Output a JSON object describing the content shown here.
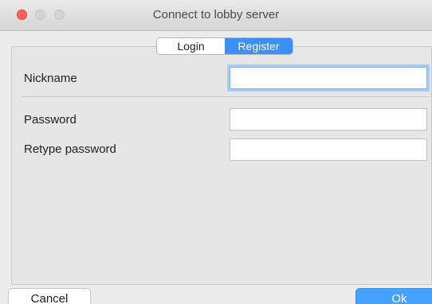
{
  "window": {
    "title": "Connect to lobby server"
  },
  "tabs": {
    "login": "Login",
    "register": "Register"
  },
  "form": {
    "nickname_label": "Nickname",
    "nickname_value": "",
    "password_label": "Password",
    "password_value": "",
    "retype_label": "Retype password",
    "retype_value": ""
  },
  "buttons": {
    "cancel": "Cancel",
    "ok": "Ok"
  },
  "colors": {
    "accent": "#3b8ff5",
    "close": "#fd5f57",
    "ok_button": "#45a1ff"
  }
}
